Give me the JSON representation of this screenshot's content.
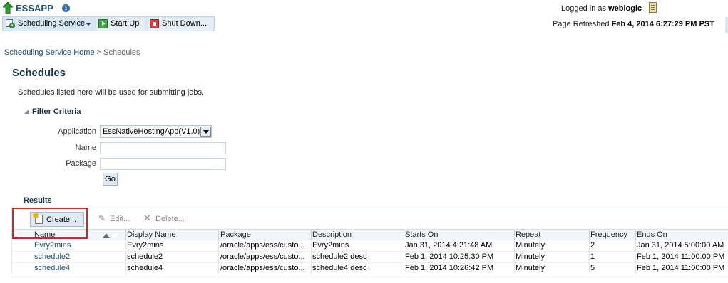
{
  "header": {
    "app_title": "ESSAPP",
    "info_glyph": "i",
    "logged_in_prefix": "Logged in as",
    "username": "weblogic",
    "page_refreshed_prefix": "Page Refreshed",
    "page_refreshed_time": "Feb 4, 2014 6:27:29 PM PST"
  },
  "toolbar": {
    "scheduling_service_label": "Scheduling Service",
    "start_up_label": "Start Up",
    "shut_down_label": "Shut Down..."
  },
  "breadcrumb": {
    "home": "Scheduling Service Home",
    "separator": ">",
    "current": "Schedules"
  },
  "page": {
    "title": "Schedules",
    "description": "Schedules listed here will be used for submitting jobs."
  },
  "filter": {
    "header": "Filter Criteria",
    "application_label": "Application",
    "application_value": "EssNativeHostingApp(V1.0)",
    "name_label": "Name",
    "name_value": "",
    "package_label": "Package",
    "package_value": "",
    "go_label": "Go"
  },
  "results": {
    "label": "Results",
    "create_label": "Create...",
    "edit_label": "Edit...",
    "delete_label": "Delete...",
    "columns": [
      "Name",
      "Display Name",
      "Package",
      "Description",
      "Starts On",
      "Repeat",
      "Frequency",
      "Ends On"
    ],
    "rows": [
      [
        "Evry2mins",
        "Evry2mins",
        "/oracle/apps/ess/custo...",
        "Evry2mins",
        "Jan 31, 2014 4:21:48 AM",
        "Minutely",
        "2",
        "Jan 31, 2014 5:00:00 AM"
      ],
      [
        "schedule2",
        "schedule2",
        "/oracle/apps/ess/custo...",
        "schedule2 desc",
        "Feb 1, 2014 10:25:30 PM",
        "Minutely",
        "1",
        "Feb 1, 2014 11:00:00 PM"
      ],
      [
        "schedule4",
        "schedule4",
        "/oracle/apps/ess/custo...",
        "schedule4 desc",
        "Feb 1, 2014 10:26:42 PM",
        "Minutely",
        "5",
        "Feb 1, 2014 11:00:00 PM"
      ]
    ]
  },
  "icons": {
    "app": "up-arrow-icon",
    "info": "info-icon",
    "user": "user-document-icon",
    "scheduling_service": "scheduling-service-icon",
    "start_up": "start-up-icon",
    "shut_down": "shut-down-icon",
    "create": "create-icon",
    "edit": "edit-pencil-icon",
    "delete": "delete-x-icon"
  },
  "colors": {
    "accent": "#1b4f73",
    "toolbar_bg": "#d8e7f4",
    "highlight": "#e21f1f"
  }
}
